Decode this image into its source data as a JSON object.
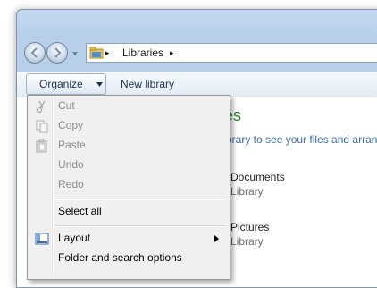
{
  "window": {
    "address": {
      "crumb": "Libraries",
      "separator": "▸"
    }
  },
  "toolbar": {
    "organize_label": "Organize",
    "new_library_label": "New library"
  },
  "content": {
    "title_partial": "es",
    "subtitle_partial": "brary to see your files and arrang",
    "items": [
      {
        "name": "Documents",
        "type": "Library"
      },
      {
        "name": "Pictures",
        "type": "Library"
      }
    ]
  },
  "organize_menu": {
    "items": [
      {
        "label": "Cut",
        "enabled": false,
        "icon": "scissors-icon"
      },
      {
        "label": "Copy",
        "enabled": false,
        "icon": "copy-icon"
      },
      {
        "label": "Paste",
        "enabled": false,
        "icon": "paste-icon"
      },
      {
        "label": "Undo",
        "enabled": false
      },
      {
        "label": "Redo",
        "enabled": false
      },
      {
        "label": "Select all",
        "enabled": true
      },
      {
        "label": "Layout",
        "enabled": true,
        "icon": "layout-icon",
        "submenu": true
      },
      {
        "label": "Folder and search options",
        "enabled": true
      }
    ]
  },
  "colors": {
    "accent_green": "#2b8a2b",
    "link_blue": "#3b6ea5",
    "disabled_text": "#8d8d8d"
  }
}
